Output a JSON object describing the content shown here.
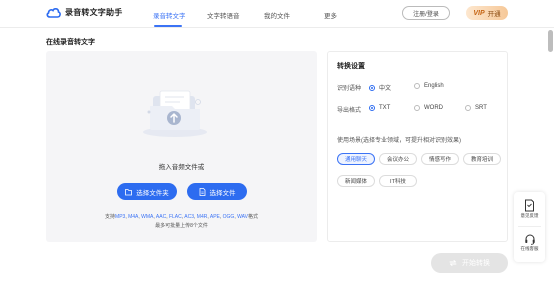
{
  "header": {
    "app_title": "录音转文字助手",
    "nav": [
      "录音转文字",
      "文字转语音",
      "我的文件",
      "更多"
    ],
    "login_label": "注册/登录",
    "vip_badge": "VIP",
    "vip_label": "开通"
  },
  "upload": {
    "section_title": "在线录音转文字",
    "drop_text": "拖入音频文件或",
    "folder_button": "选择文件夹",
    "file_button": "选择文件",
    "formats_prefix": "支持",
    "formats": [
      "MP3",
      "M4A",
      "WMA",
      "AAC",
      "FLAC",
      "AC3",
      "M4R",
      "APE",
      "OGG",
      "WAV"
    ],
    "formats_suffix": "格式",
    "limit_text": "最多可批量上传8个文件"
  },
  "settings": {
    "title": "转换设置",
    "language_label": "识别语种",
    "languages": [
      {
        "label": "中文",
        "selected": true
      },
      {
        "label": "English",
        "selected": false
      }
    ],
    "format_label": "导出格式",
    "formats": [
      {
        "label": "TXT",
        "selected": true
      },
      {
        "label": "WORD",
        "selected": false
      },
      {
        "label": "SRT",
        "selected": false
      }
    ],
    "scene_label": "使用场景(选择专业领域，可提升相对识别效果)",
    "scenes": [
      {
        "label": "通用聊天",
        "selected": true
      },
      {
        "label": "会议办公",
        "selected": false
      },
      {
        "label": "情感写作",
        "selected": false
      },
      {
        "label": "教育培训",
        "selected": false
      },
      {
        "label": "新闻媒体",
        "selected": false
      },
      {
        "label": "IT科技",
        "selected": false
      }
    ]
  },
  "start_button": "开始转换",
  "side_tools": {
    "feedback": "意见反馈",
    "service": "在线客服"
  },
  "colors": {
    "accent": "#2d6cf0",
    "panel_bg": "#f5f5f7",
    "disabled": "#e4e4e4"
  }
}
